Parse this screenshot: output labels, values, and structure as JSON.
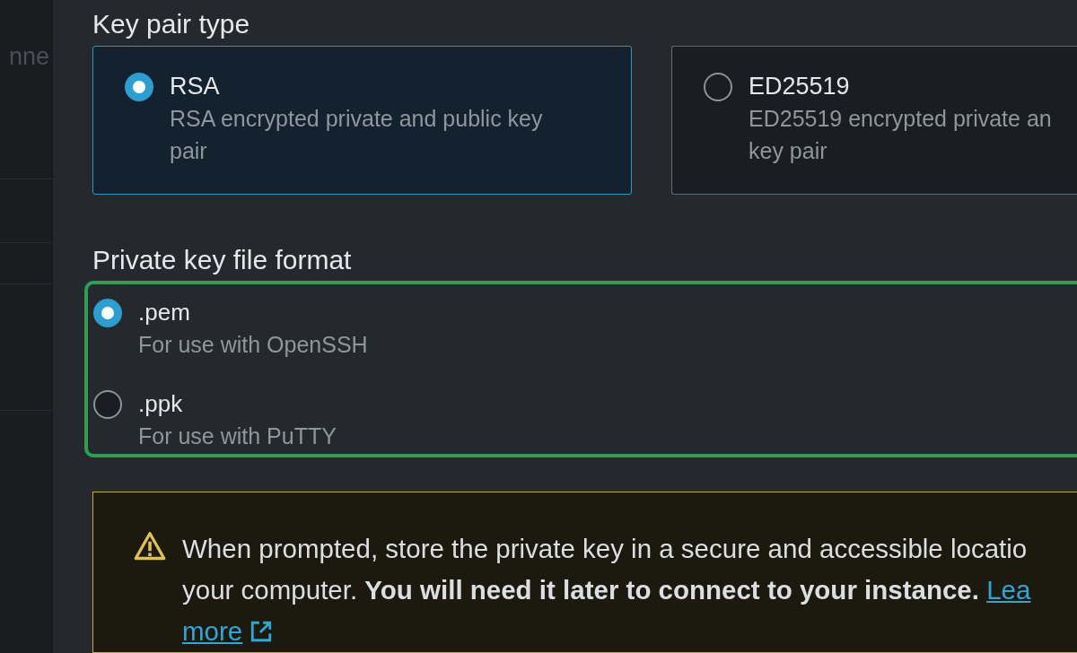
{
  "sidebar": {
    "text": "nne"
  },
  "key_pair_type": {
    "label": "Key pair type",
    "options": [
      {
        "title": "RSA",
        "description": "RSA encrypted private and public key pair",
        "selected": true
      },
      {
        "title": "ED25519",
        "description": "ED25519 encrypted private an key pair",
        "selected": false
      }
    ]
  },
  "private_key_file_format": {
    "label": "Private key file format",
    "options": [
      {
        "title": ".pem",
        "description": "For use with OpenSSH",
        "selected": true
      },
      {
        "title": ".ppk",
        "description": "For use with PuTTY",
        "selected": false
      }
    ]
  },
  "warning": {
    "lines": [
      "When prompted, store the private key in a secure and accessible locatio",
      "your computer. **You will need it later to connect to your instance.**"
    ],
    "link_lines": [
      "Lea",
      "more"
    ]
  }
}
